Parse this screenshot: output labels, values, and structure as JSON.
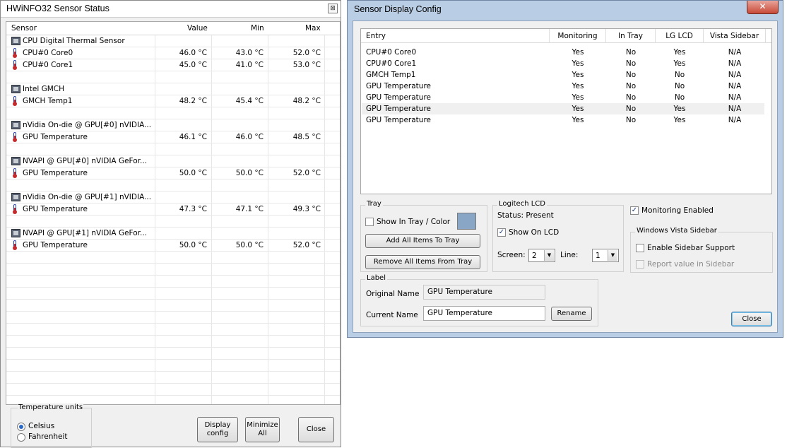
{
  "sensor_window": {
    "title": "HWiNFO32 Sensor Status",
    "close_glyph": "⊠",
    "columns": [
      "Sensor",
      "Value",
      "Min",
      "Max"
    ],
    "rows": [
      {
        "kind": "group",
        "name": "CPU Digital Thermal Sensor",
        "icon": "chip-icon"
      },
      {
        "kind": "item",
        "name": "CPU#0 Core0",
        "value": "46.0 °C",
        "min": "43.0 °C",
        "max": "52.0 °C",
        "icon": "thermometer-icon"
      },
      {
        "kind": "item",
        "name": "CPU#0 Core1",
        "value": "45.0 °C",
        "min": "41.0 °C",
        "max": "53.0 °C",
        "icon": "thermometer-icon"
      },
      {
        "kind": "blank"
      },
      {
        "kind": "group",
        "name": "Intel GMCH",
        "icon": "chip-icon"
      },
      {
        "kind": "item",
        "name": "GMCH Temp1",
        "value": "48.2 °C",
        "min": "45.4 °C",
        "max": "48.2 °C",
        "icon": "thermometer-icon"
      },
      {
        "kind": "blank"
      },
      {
        "kind": "group",
        "name": "nVidia On-die @ GPU[#0] nVIDIA...",
        "icon": "chip-icon"
      },
      {
        "kind": "item",
        "name": "GPU Temperature",
        "value": "46.1 °C",
        "min": "46.0 °C",
        "max": "48.5 °C",
        "icon": "thermometer-icon"
      },
      {
        "kind": "blank"
      },
      {
        "kind": "group",
        "name": "NVAPI @ GPU[#0] nVIDIA GeFor...",
        "icon": "chip-icon"
      },
      {
        "kind": "item",
        "name": "GPU Temperature",
        "value": "50.0 °C",
        "min": "50.0 °C",
        "max": "52.0 °C",
        "icon": "thermometer-icon"
      },
      {
        "kind": "blank"
      },
      {
        "kind": "group",
        "name": "nVidia On-die @ GPU[#1] nVIDIA...",
        "icon": "chip-icon"
      },
      {
        "kind": "item",
        "name": "GPU Temperature",
        "value": "47.3 °C",
        "min": "47.1 °C",
        "max": "49.3 °C",
        "icon": "thermometer-icon"
      },
      {
        "kind": "blank"
      },
      {
        "kind": "group",
        "name": "NVAPI @ GPU[#1] nVIDIA GeFor...",
        "icon": "chip-icon"
      },
      {
        "kind": "item",
        "name": "GPU Temperature",
        "value": "50.0 °C",
        "min": "50.0 °C",
        "max": "52.0 °C",
        "icon": "thermometer-icon"
      }
    ],
    "temperature_units": {
      "label": "Temperature units",
      "options": [
        "Celsius",
        "Fahrenheit"
      ],
      "selected": "Celsius"
    },
    "buttons": {
      "display_config": [
        "Display",
        "config"
      ],
      "minimize_all": [
        "Minimize",
        "All"
      ],
      "close": "Close"
    }
  },
  "config_window": {
    "title": "Sensor Display Config",
    "title_close_glyph": "✕",
    "list": {
      "columns": [
        "Entry",
        "Monitoring",
        "In Tray",
        "LG LCD",
        "Vista Sidebar"
      ],
      "rows": [
        [
          "CPU#0 Core0",
          "Yes",
          "No",
          "Yes",
          "N/A"
        ],
        [
          "CPU#0 Core1",
          "Yes",
          "No",
          "Yes",
          "N/A"
        ],
        [
          "GMCH Temp1",
          "Yes",
          "No",
          "No",
          "N/A"
        ],
        [
          "GPU Temperature",
          "Yes",
          "No",
          "No",
          "N/A"
        ],
        [
          "GPU Temperature",
          "Yes",
          "No",
          "No",
          "N/A"
        ],
        [
          "GPU Temperature",
          "Yes",
          "No",
          "Yes",
          "N/A"
        ],
        [
          "GPU Temperature",
          "Yes",
          "No",
          "Yes",
          "N/A"
        ]
      ],
      "selected_index": 5
    },
    "tray": {
      "label": "Tray",
      "show_in_tray_label": "Show In Tray / Color",
      "show_in_tray_checked": false,
      "swatch_color": "#8aa6c6",
      "add_all_button": "Add All Items To Tray",
      "remove_all_button": "Remove All Items From Tray"
    },
    "logitech": {
      "label": "Logitech LCD",
      "status": "Status: Present",
      "show_on_lcd_label": "Show On LCD",
      "show_on_lcd_checked": true,
      "screen_label": "Screen:",
      "screen_value": "2",
      "line_label": "Line:",
      "line_value": "1"
    },
    "monitoring_enabled_label": "Monitoring Enabled",
    "monitoring_enabled_checked": true,
    "vista": {
      "label": "Windows Vista Sidebar",
      "enable_label": "Enable Sidebar Support",
      "enable_checked": false,
      "report_label": "Report value in Sidebar",
      "report_enabled": false
    },
    "label_group": {
      "label": "Label",
      "original_name_label": "Original Name",
      "original_name_value": "GPU Temperature",
      "current_name_label": "Current Name",
      "current_name_value": "GPU Temperature",
      "rename_button": "Rename"
    },
    "close_button": "Close"
  }
}
